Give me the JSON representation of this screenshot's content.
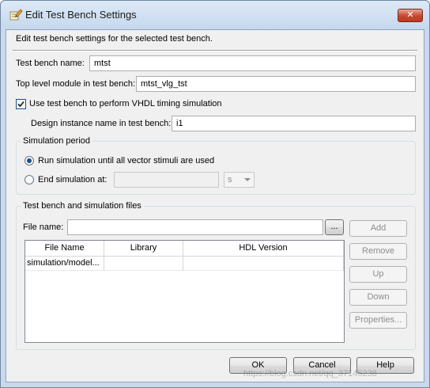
{
  "window": {
    "title": "Edit Test Bench Settings",
    "close_glyph": "✕"
  },
  "description": "Edit test bench settings for the selected test bench.",
  "fields": {
    "test_bench_name": {
      "label": "Test bench name:",
      "value": "mtst"
    },
    "top_level_module": {
      "label": "Top level module in test bench:",
      "value": "mtst_vlg_tst"
    },
    "use_test_bench": {
      "label": "Use test bench to perform VHDL timing simulation",
      "checked": true
    },
    "design_instance": {
      "label": "Design instance name in test bench:",
      "value": "i1"
    }
  },
  "simulation_period": {
    "title": "Simulation period",
    "run_until_done": {
      "label": "Run simulation until all vector stimuli are used",
      "selected": true
    },
    "end_at": {
      "label": "End simulation at:",
      "value": "",
      "unit": "s",
      "selected": false
    }
  },
  "files_group": {
    "title": "Test bench and simulation files",
    "file_name_label": "File name:",
    "file_name_value": "",
    "browse_label": "...",
    "buttons": {
      "add": "Add",
      "remove": "Remove",
      "up": "Up",
      "down": "Down",
      "properties": "Properties..."
    },
    "columns": [
      "File Name",
      "Library",
      "HDL Version"
    ],
    "rows": [
      [
        "simulation/model...",
        "",
        ""
      ]
    ]
  },
  "footer": {
    "ok": "OK",
    "cancel": "Cancel",
    "help": "Help"
  },
  "watermark": "https://blog.csdn.net/qq_37145238"
}
